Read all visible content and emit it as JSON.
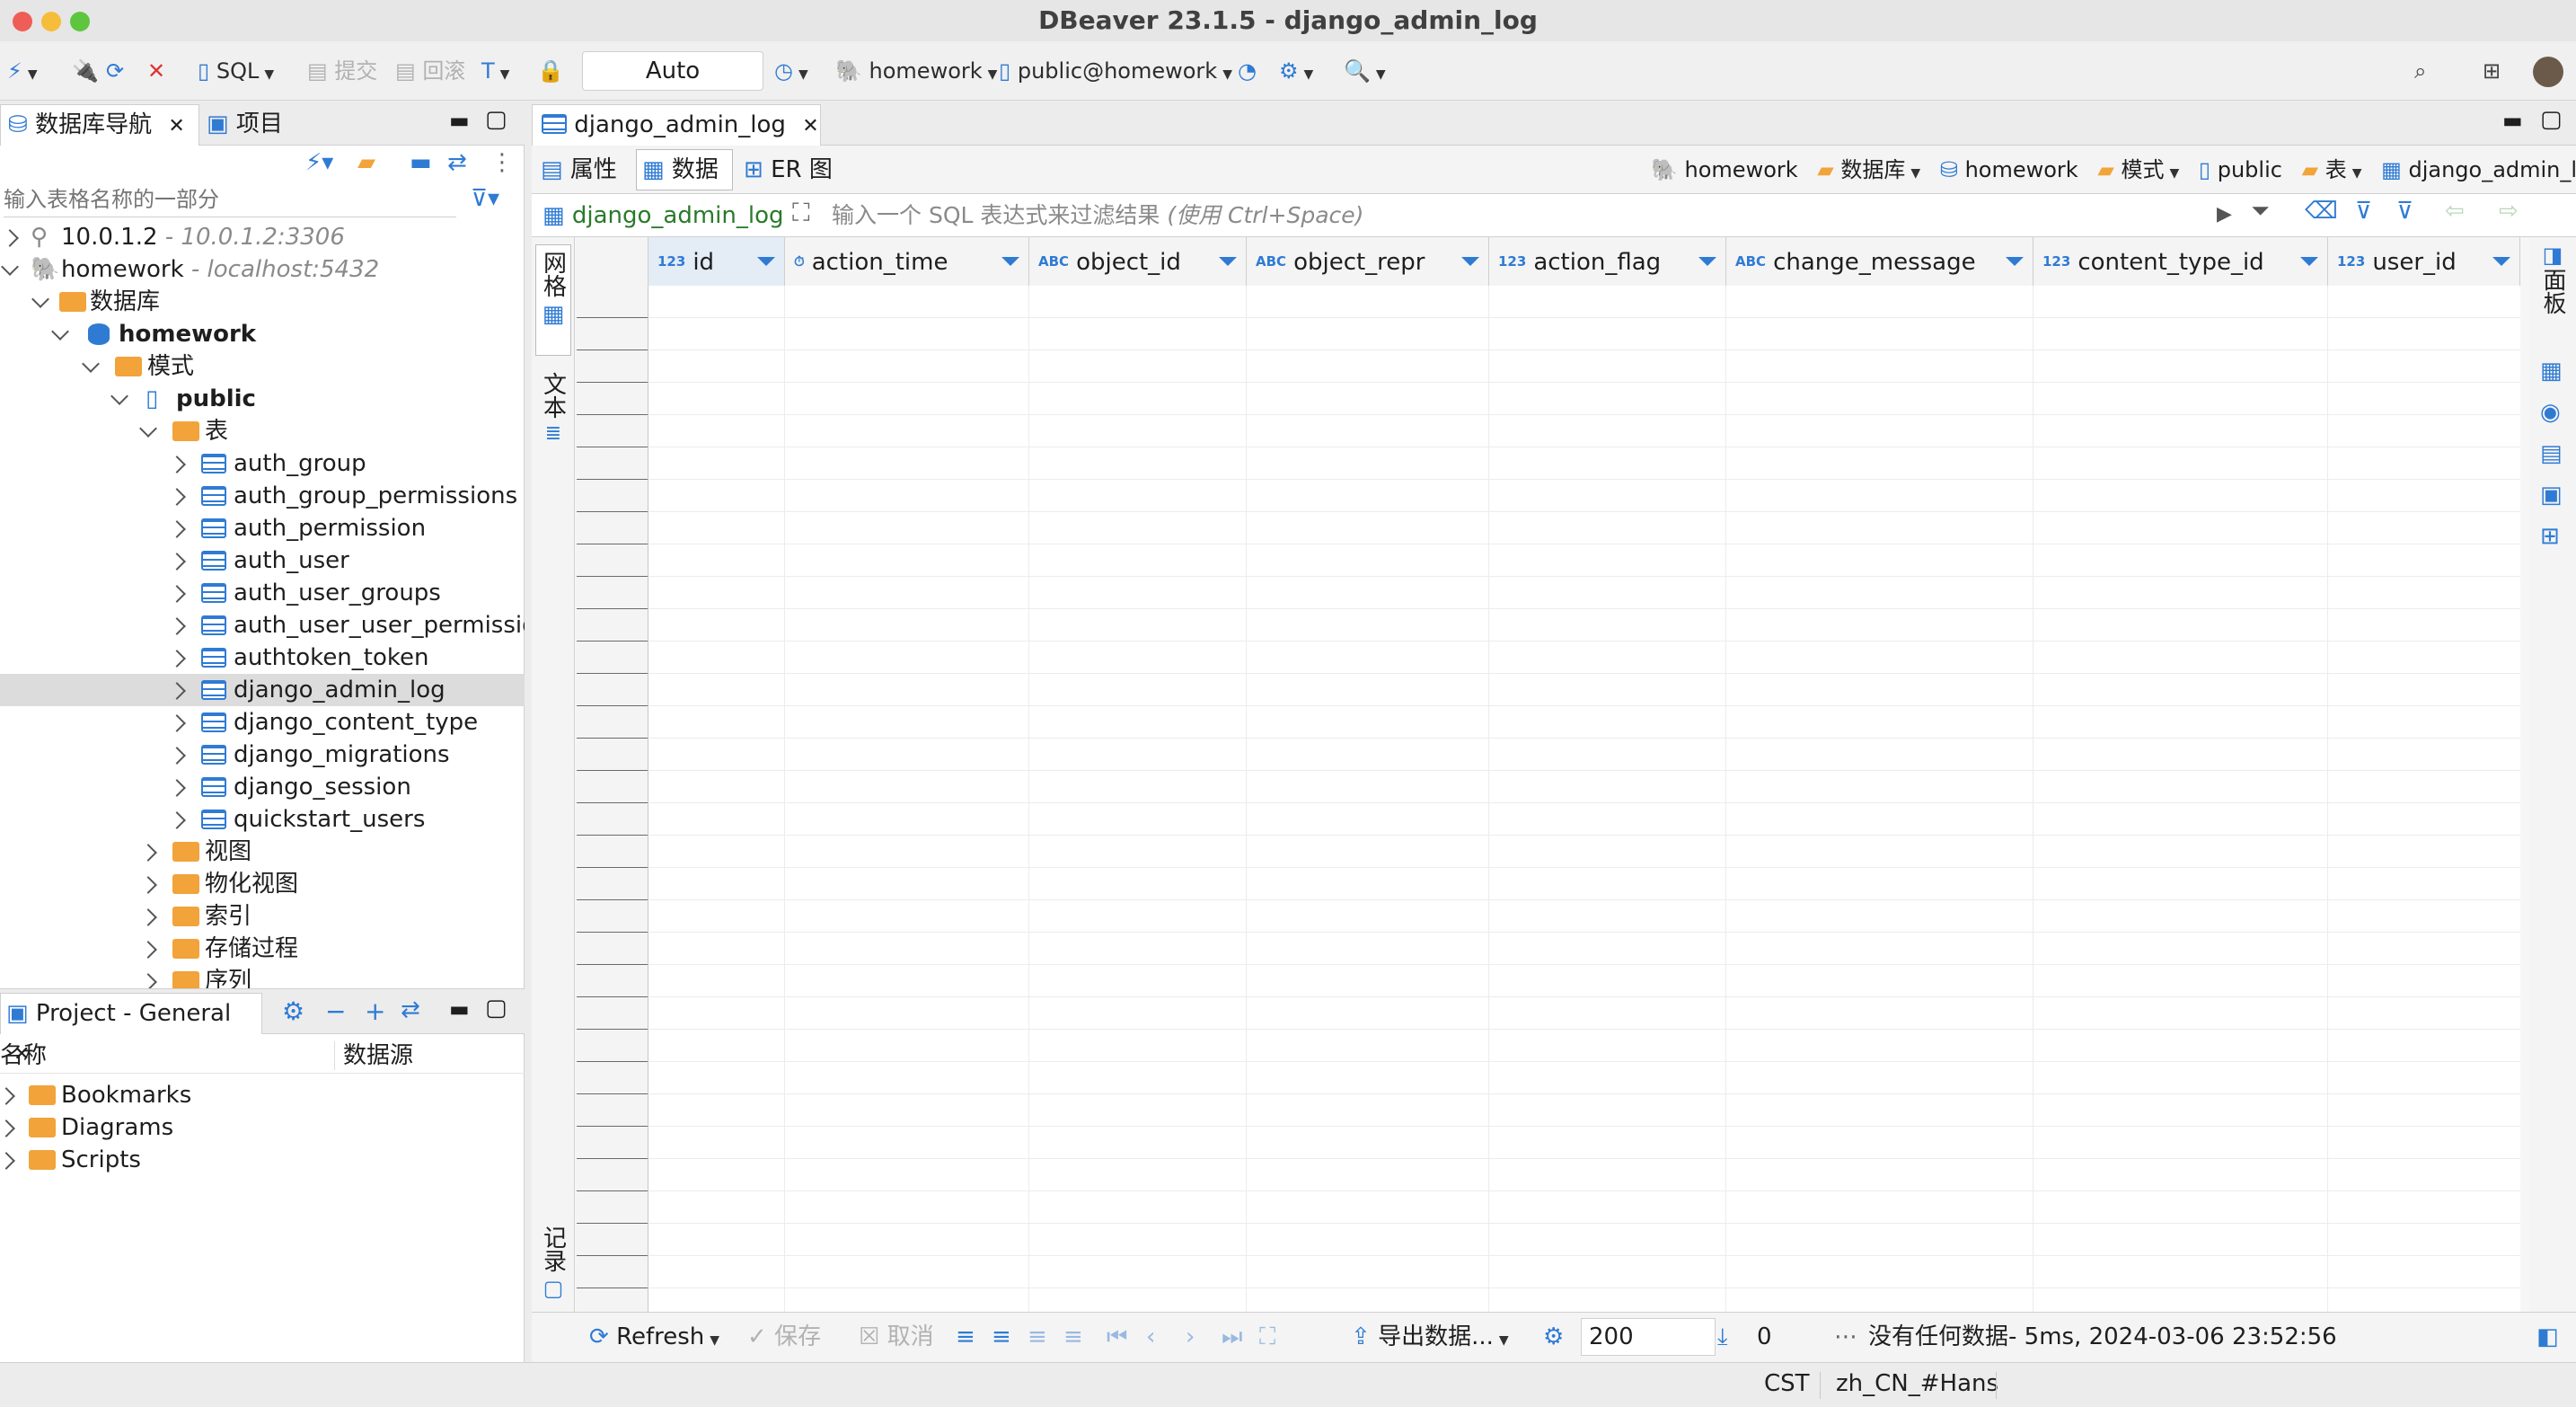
{
  "window": {
    "title": "DBeaver 23.1.5 - django_admin_log"
  },
  "toolbar": {
    "sql_label": "SQL",
    "commit_label": "提交",
    "rollback_label": "回滚",
    "mode_value": "Auto",
    "datasource_label": "homework",
    "schema_label": "public@homework"
  },
  "navigator": {
    "tab_db": "数据库导航",
    "tab_project": "项目",
    "filter_placeholder": "输入表格名称的一部分",
    "items": [
      {
        "label": "10.0.1.2",
        "hint": " - 10.0.1.2:3306"
      },
      {
        "label": "homework",
        "hint": " - localhost:5432"
      },
      {
        "label": "数据库"
      },
      {
        "label": "homework"
      },
      {
        "label": "模式"
      },
      {
        "label": "public"
      },
      {
        "label": "表"
      },
      {
        "label": "auth_group"
      },
      {
        "label": "auth_group_permissions"
      },
      {
        "label": "auth_permission"
      },
      {
        "label": "auth_user"
      },
      {
        "label": "auth_user_groups"
      },
      {
        "label": "auth_user_user_permissio"
      },
      {
        "label": "authtoken_token"
      },
      {
        "label": "django_admin_log"
      },
      {
        "label": "django_content_type"
      },
      {
        "label": "django_migrations"
      },
      {
        "label": "django_session"
      },
      {
        "label": "quickstart_users"
      },
      {
        "label": "视图"
      },
      {
        "label": "物化视图"
      },
      {
        "label": "索引"
      },
      {
        "label": "存储过程"
      },
      {
        "label": "序列"
      }
    ]
  },
  "project": {
    "tab_label": "Project - General",
    "col_name": "名称",
    "col_source": "数据源",
    "items": [
      "Bookmarks",
      "Diagrams",
      "Scripts"
    ]
  },
  "editor": {
    "tab_label": "django_admin_log",
    "subtabs": [
      "属性",
      "数据",
      "ER 图"
    ],
    "breadcrumb": [
      "homework",
      "数据库",
      "homework",
      "模式",
      "public",
      "表",
      "django_admin_log"
    ],
    "table_name": "django_admin_log",
    "filter_placeholder": "输入一个 SQL 表达式来过滤结果",
    "filter_hint": "(使用 Ctrl+Space)",
    "columns": [
      {
        "type": "123",
        "name": "id"
      },
      {
        "type": "⏱",
        "name": "action_time"
      },
      {
        "type": "ABC",
        "name": "object_id"
      },
      {
        "type": "ABC",
        "name": "object_repr"
      },
      {
        "type": "123",
        "name": "action_flag"
      },
      {
        "type": "ABC",
        "name": "change_message"
      },
      {
        "type": "123",
        "name": "content_type_id"
      },
      {
        "type": "123",
        "name": "user_id"
      }
    ],
    "side_tabs": {
      "grid": "网格",
      "text": "文本",
      "record": "记录"
    },
    "right_tab": "面板"
  },
  "bottom_bar": {
    "refresh": "Refresh",
    "save": "保存",
    "cancel": "取消",
    "export": "导出数据...",
    "fetch_size": "200",
    "row_count": "0",
    "message": "没有任何数据- 5ms, 2024-03-06 23:52:56"
  },
  "statusbar": {
    "timezone": "CST",
    "locale": "zh_CN_#Hans"
  },
  "colors": {
    "accent": "#2f7bd4",
    "folder": "#f2a33a",
    "selection": "#dcdcdc"
  }
}
